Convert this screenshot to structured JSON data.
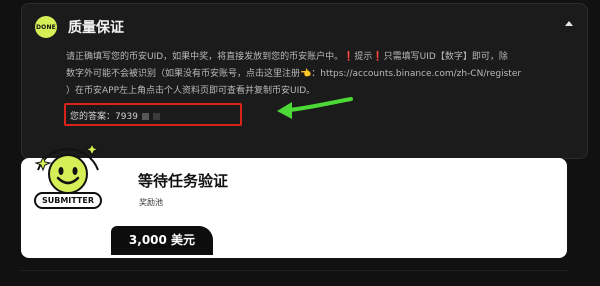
{
  "qa_card": {
    "badge": "DONE",
    "title": "质量保证",
    "instruction_1": "请正确填写您的币安UID，如果中奖，将直接发放到您的币安账户中。",
    "warn_mark_1": "❗",
    "hint_label": "提示",
    "warn_mark_2": "❗",
    "instruction_2": "只需填写UID【数字】即可，除",
    "instruction_3": "数字外可能不会被识别（如果没有币安账号，点击这里注册",
    "pointer_glyph": "👈",
    "instruction_4": "：https://accounts.binance.com/zh-CN/register",
    "instruction_5": "）在币安APP左上角点击个人资料页即可查看并复制币安UID。",
    "answer_label": "您的答案：",
    "answer_value": "7939"
  },
  "task_card": {
    "badge": "SUBMITTER",
    "title": "等待任务验证",
    "pool_label": "奖励池",
    "prize": "3,000 美元"
  },
  "colors": {
    "accent": "#d6ef57",
    "highlight_border": "#d8241a",
    "arrow": "#4cd836",
    "background": "#111111"
  },
  "icons": {
    "collapse": "chevron-up-icon",
    "mascot": "smiley-face-icon",
    "arrow": "pointing-arrow"
  }
}
